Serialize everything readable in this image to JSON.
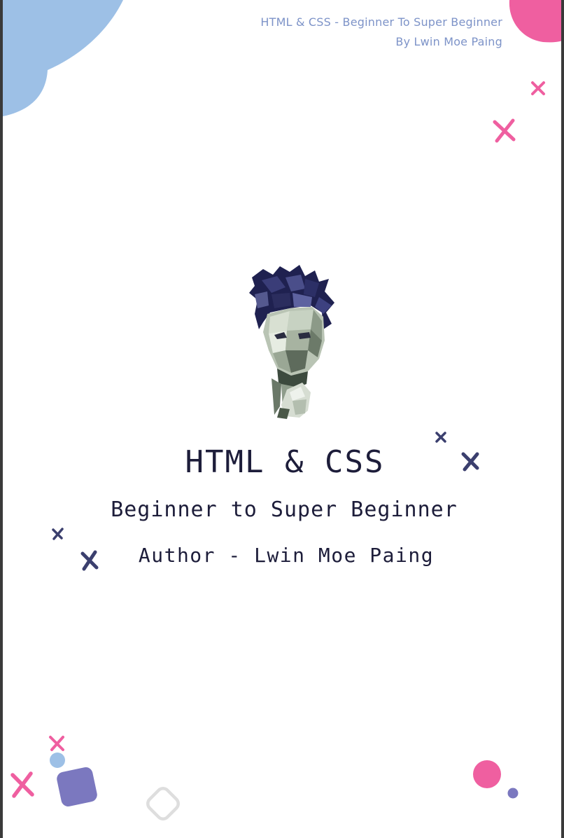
{
  "header": {
    "line1": "HTML & CSS - Beginner To Super Beginner",
    "line2": "By Lwin Moe Paing"
  },
  "cover": {
    "title": "HTML & CSS",
    "subtitle": "Beginner to Super Beginner",
    "author": "Author - Lwin Moe Paing"
  },
  "colors": {
    "blue_blob": "#9dc0e6",
    "pink": "#ef5fa0",
    "navy": "#3b3f6e",
    "purple": "#7b78bf",
    "grey_outline": "#dedede",
    "text": "#1d1d3a",
    "header_text": "#7d93c8"
  },
  "icons": {
    "portrait": "low-poly-author-portrait",
    "cross": "x-mark-decoration",
    "dot": "circle-decoration",
    "rounded_square": "rounded-square-decoration"
  }
}
